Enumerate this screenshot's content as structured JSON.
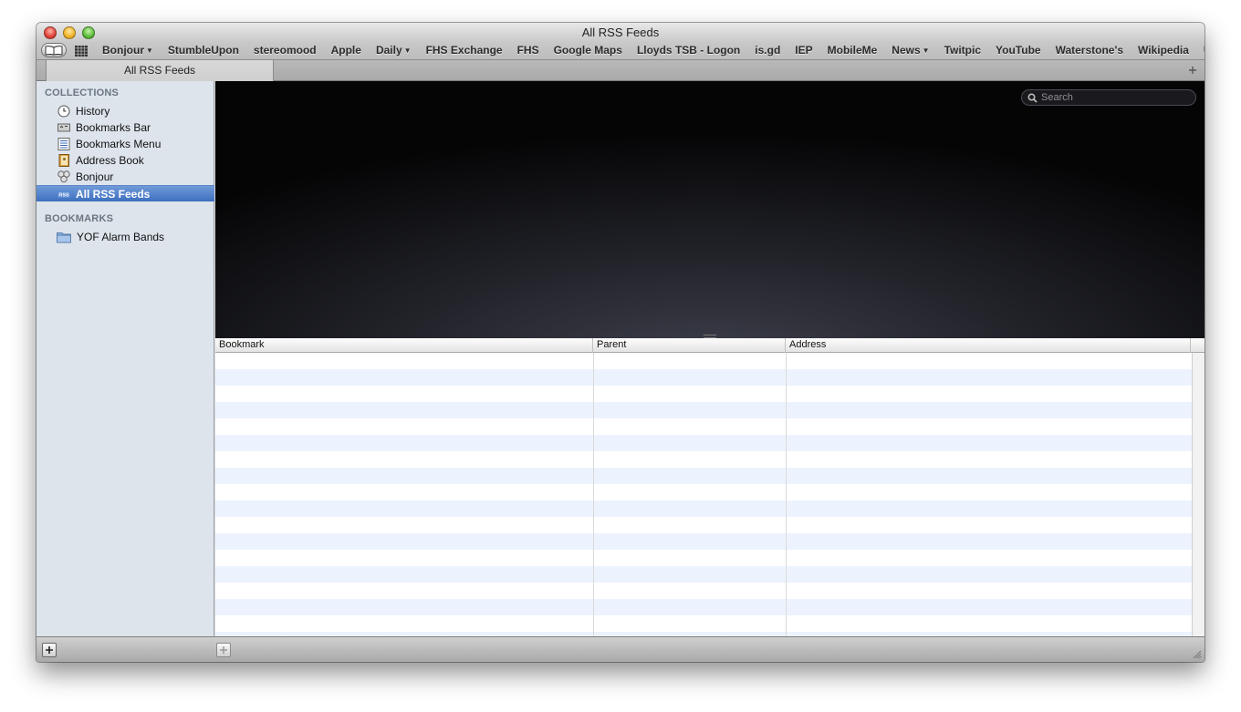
{
  "window": {
    "title": "All RSS Feeds"
  },
  "bookmarks_bar": {
    "items": [
      {
        "label": "Bonjour",
        "has_menu": true
      },
      {
        "label": "StumbleUpon",
        "has_menu": false
      },
      {
        "label": "stereomood",
        "has_menu": false
      },
      {
        "label": "Apple",
        "has_menu": false
      },
      {
        "label": "Daily",
        "has_menu": true
      },
      {
        "label": "FHS Exchange",
        "has_menu": false
      },
      {
        "label": "FHS",
        "has_menu": false
      },
      {
        "label": "Google Maps",
        "has_menu": false
      },
      {
        "label": "Lloyds TSB - Logon",
        "has_menu": false
      },
      {
        "label": "is.gd",
        "has_menu": false
      },
      {
        "label": "IEP",
        "has_menu": false
      },
      {
        "label": "MobileMe",
        "has_menu": false
      },
      {
        "label": "News",
        "has_menu": true
      },
      {
        "label": "Twitpic",
        "has_menu": false
      },
      {
        "label": "YouTube",
        "has_menu": false
      },
      {
        "label": "Waterstone's",
        "has_menu": false
      },
      {
        "label": "Wikipedia",
        "has_menu": false
      },
      {
        "label": "UCAS",
        "has_menu": false
      }
    ]
  },
  "tabs": [
    {
      "label": "All RSS Feeds",
      "active": true
    }
  ],
  "sidebar": {
    "collections_header": "COLLECTIONS",
    "collections": [
      {
        "label": "History",
        "icon": "clock-icon",
        "selected": false
      },
      {
        "label": "Bookmarks Bar",
        "icon": "bookmarks-bar-icon",
        "selected": false
      },
      {
        "label": "Bookmarks Menu",
        "icon": "bookmarks-menu-icon",
        "selected": false
      },
      {
        "label": "Address Book",
        "icon": "address-book-icon",
        "selected": false
      },
      {
        "label": "Bonjour",
        "icon": "bonjour-icon",
        "selected": false
      },
      {
        "label": "All RSS Feeds",
        "icon": "rss-icon",
        "selected": true
      }
    ],
    "bookmarks_header": "BOOKMARKS",
    "bookmarks": [
      {
        "label": "YOF Alarm Bands",
        "icon": "folder-icon"
      }
    ]
  },
  "search": {
    "placeholder": "Search",
    "value": ""
  },
  "table": {
    "columns": [
      "Bookmark",
      "Parent",
      "Address"
    ],
    "rows": []
  },
  "colors": {
    "selection": "#3e6fbf",
    "sidebar_bg": "#dde4ec",
    "row_alt": "#edf3fe"
  }
}
